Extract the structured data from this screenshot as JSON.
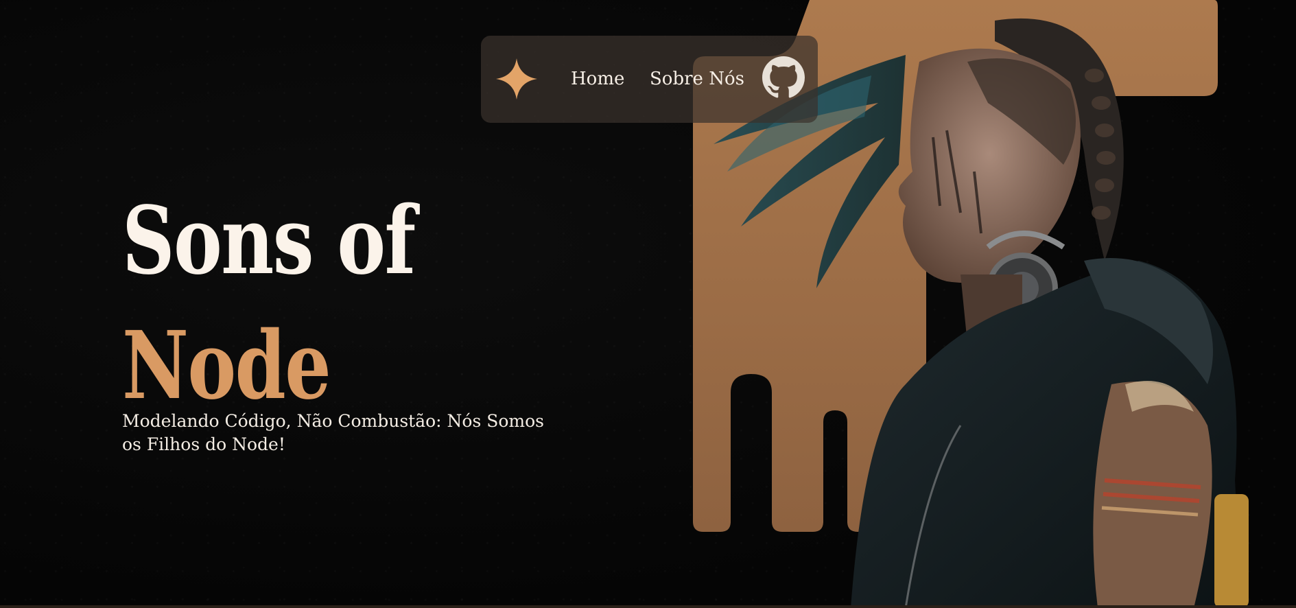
{
  "nav": {
    "logo_icon": "four-point-star-icon",
    "links": [
      {
        "label": "Home"
      },
      {
        "label": "Sobre Nós"
      }
    ],
    "github_icon": "github-icon"
  },
  "hero": {
    "title_line_1": "Sons of",
    "title_line_2": "Node",
    "tagline": "Modelando Código, Não Combustão: Nós Somos os Filhos do Node!"
  },
  "colors": {
    "background": "#060606",
    "accent": "#d99a63",
    "drip": "#a06f46",
    "text": "#fbf3ea",
    "nav_bg": "#3a322c"
  }
}
